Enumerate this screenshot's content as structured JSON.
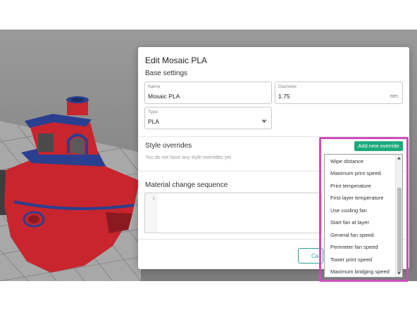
{
  "colors": {
    "accent": "#1ea97c",
    "highlight": "#cc4dbb",
    "boat_red": "#c8252f",
    "boat_blue": "#2a3f8f"
  },
  "dialog": {
    "title": "Edit Mosaic PLA",
    "base_settings": {
      "heading": "Base settings",
      "name_label": "Name",
      "name_value": "Mosaic PLA",
      "diameter_label": "Diameter",
      "diameter_value": "1.75",
      "diameter_unit": "mm",
      "type_label": "Type",
      "type_value": "PLA",
      "type_icon": "chevron-down-icon"
    },
    "style_overrides": {
      "heading": "Style overrides",
      "empty_text": "You do not have any style overrides yet.",
      "add_button": "Add new override"
    },
    "material_change": {
      "heading": "Material change sequence",
      "line_numbers": [
        "1"
      ]
    },
    "cancel_button": "Ca"
  },
  "override_menu": {
    "items": [
      "Wipe distance",
      "Maximum print speed",
      "Print temperature",
      "First layer temperature",
      "Use cooling fan",
      "Start fan at layer",
      "General fan speed",
      "Perimeter fan speed",
      "Tower print speed",
      "Maximum bridging speed"
    ]
  }
}
